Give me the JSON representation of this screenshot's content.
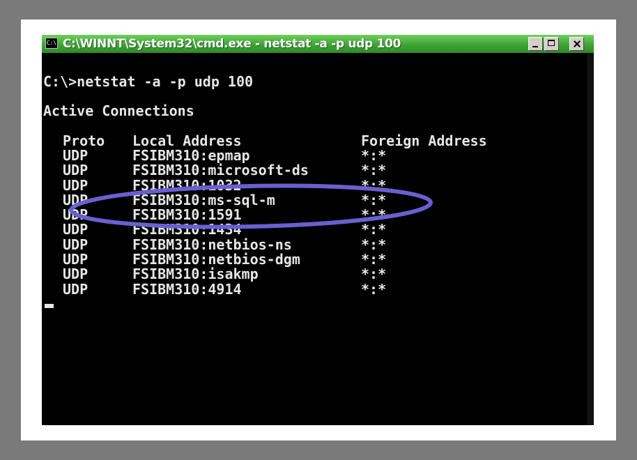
{
  "window": {
    "title": "C:\\WINNT\\System32\\cmd.exe - netstat -a -p udp 100",
    "icon": "console-app-icon",
    "icon_glyph": "C:\\"
  },
  "console": {
    "command_line": "C:\\>netstat -a -p udp 100",
    "section_title": "Active Connections",
    "columns": {
      "proto": "Proto",
      "local": "Local Address",
      "foreign": "Foreign Address"
    },
    "rows": [
      {
        "proto": "UDP",
        "local": "FSIBM310:epmap",
        "foreign": "*:*"
      },
      {
        "proto": "UDP",
        "local": "FSIBM310:microsoft-ds",
        "foreign": "*:*"
      },
      {
        "proto": "UDP",
        "local": "FSIBM310:1032",
        "foreign": "*:*"
      },
      {
        "proto": "UDP",
        "local": "FSIBM310:ms-sql-m",
        "foreign": "*:*"
      },
      {
        "proto": "UDP",
        "local": "FSIBM310:1591",
        "foreign": "*:*"
      },
      {
        "proto": "UDP",
        "local": "FSIBM310:1434",
        "foreign": "*:*"
      },
      {
        "proto": "UDP",
        "local": "FSIBM310:netbios-ns",
        "foreign": "*:*"
      },
      {
        "proto": "UDP",
        "local": "FSIBM310:netbios-dgm",
        "foreign": "*:*"
      },
      {
        "proto": "UDP",
        "local": "FSIBM310:isakmp",
        "foreign": "*:*"
      },
      {
        "proto": "UDP",
        "local": "FSIBM310:4914",
        "foreign": "*:*"
      }
    ]
  },
  "colors": {
    "titlebar": "#3fa336",
    "console_bg": "#000000",
    "console_text": "#e6e6e6",
    "highlight_ring": "#6a5fd0"
  }
}
